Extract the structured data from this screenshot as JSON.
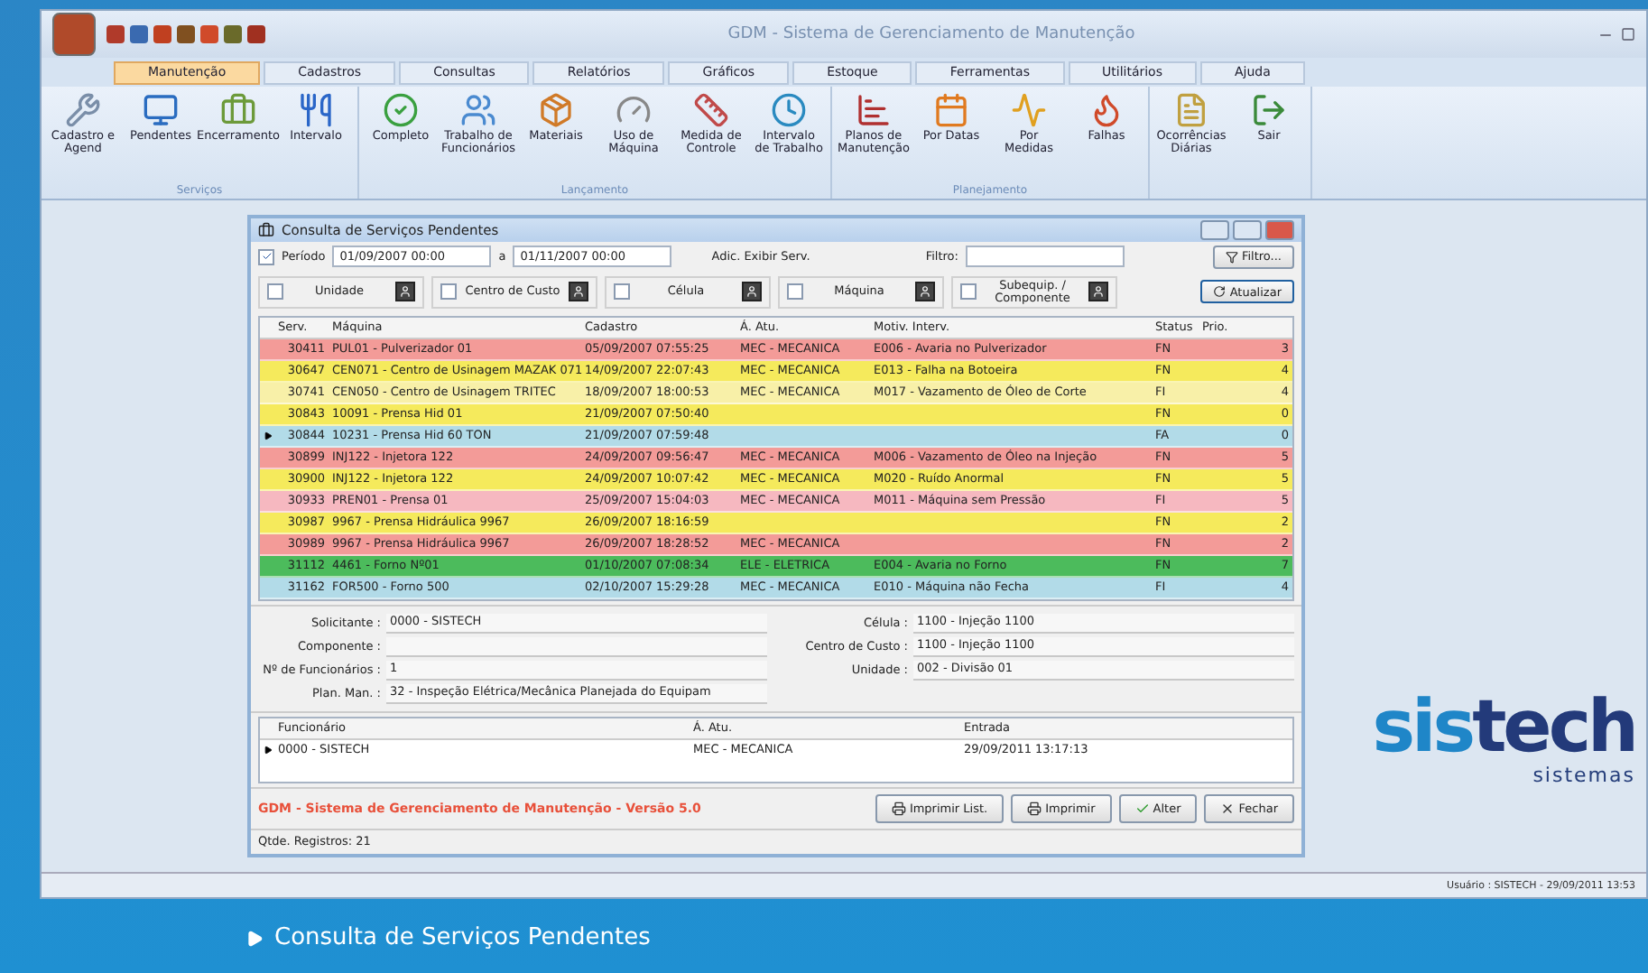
{
  "window": {
    "title": "GDM - Sistema de Gerenciamento de Manutenção"
  },
  "menu": [
    {
      "label": "Manutenção",
      "selected": true
    },
    {
      "label": "Cadastros",
      "selected": false
    },
    {
      "label": "Consultas",
      "selected": false
    },
    {
      "label": "Relatórios",
      "selected": false
    },
    {
      "label": "Gráficos",
      "selected": false
    },
    {
      "label": "Estoque",
      "selected": false
    },
    {
      "label": "Ferramentas",
      "selected": false
    },
    {
      "label": "Utilitários",
      "selected": false
    },
    {
      "label": "Ajuda",
      "selected": false
    }
  ],
  "ribbon": [
    {
      "title": "Serviços",
      "items": [
        "Cadastro e Agend",
        "Pendentes",
        "Encerramento",
        "Intervalo"
      ]
    },
    {
      "title": "Lançamento",
      "items": [
        "Completo",
        "Trabalho de Funcionários",
        "Materiais",
        "Uso de Máquina",
        "Medida de Controle",
        "Intervalo de Trabalho"
      ]
    },
    {
      "title": "Planejamento",
      "items": [
        "Planos de Manutenção",
        "Por Datas",
        "Por Medidas",
        "Falhas"
      ]
    },
    {
      "items": [
        "Ocorrências Diárias",
        "Sair"
      ]
    }
  ],
  "dialog": {
    "title": "Consulta de Serviços Pendentes",
    "period": {
      "label": "Período",
      "checked": true,
      "from": "01/09/2007 00:00",
      "sep": "a",
      "to": "01/11/2007 00:00"
    },
    "show_label": "Adic. Exibir Serv.",
    "filter_label": "Filtro:",
    "filter_button": "Filtro...",
    "refresh_button": "Atualizar",
    "filters": [
      {
        "label": "Unidade",
        "checked": false
      },
      {
        "label": "Centro de Custo",
        "checked": false
      },
      {
        "label": "Célula",
        "checked": false
      },
      {
        "label": "Máquina",
        "checked": false
      },
      {
        "label": "Subequip. / Componente",
        "checked": false
      }
    ],
    "table": {
      "columns": [
        "Serv.",
        "Máquina",
        "Cadastro",
        "Á. Atu.",
        "Motiv. Interv.",
        "Status",
        "Prio."
      ],
      "rows": [
        {
          "cells": [
            "30411",
            "PUL01 - Pulverizador 01",
            "05/09/2007 07:55:25",
            "MEC - MECANICA",
            "E006 - Avaria no Pulverizador",
            "FN",
            "3"
          ],
          "color": "#f39b98",
          "selected": false
        },
        {
          "cells": [
            "30647",
            "CEN071 - Centro de Usinagem MAZAK 071",
            "14/09/2007 22:07:43",
            "MEC - MECANICA",
            "E013 - Falha na Botoeira",
            "FN",
            "4"
          ],
          "color": "#f5ea5c",
          "selected": false
        },
        {
          "cells": [
            "30741",
            "CEN050 - Centro de Usinagem TRITEC",
            "18/09/2007 18:00:53",
            "MEC - MECANICA",
            "M017 - Vazamento de Óleo de Corte",
            "FI",
            "4"
          ],
          "color": "#f8f0a8",
          "selected": false
        },
        {
          "cells": [
            "30843",
            "10091 - Prensa Hid 01",
            "21/09/2007 07:50:40",
            "",
            "",
            "FN",
            "0"
          ],
          "color": "#f5ea5c",
          "selected": false
        },
        {
          "cells": [
            "30844",
            "10231 - Prensa Hid 60 TON",
            "21/09/2007 07:59:48",
            "",
            "",
            "FA",
            "0"
          ],
          "color": "#b2dbe8",
          "selected": true
        },
        {
          "cells": [
            "30899",
            "INJ122 - Injetora 122",
            "24/09/2007 09:56:47",
            "MEC - MECANICA",
            "M006 - Vazamento de Óleo na Injeção",
            "FN",
            "5"
          ],
          "color": "#f39b98",
          "selected": false
        },
        {
          "cells": [
            "30900",
            "INJ122 - Injetora 122",
            "24/09/2007 10:07:42",
            "MEC - MECANICA",
            "M020 - Ruído Anormal",
            "FN",
            "5"
          ],
          "color": "#f5ea5c",
          "selected": false
        },
        {
          "cells": [
            "30933",
            "PREN01 - Prensa 01",
            "25/09/2007 15:04:03",
            "MEC - MECANICA",
            "M011 - Máquina sem Pressão",
            "FI",
            "5"
          ],
          "color": "#f6b8c0",
          "selected": false
        },
        {
          "cells": [
            "30987",
            "9967 - Prensa Hidráulica 9967",
            "26/09/2007 18:16:59",
            "",
            "",
            "FN",
            "2"
          ],
          "color": "#f5ea5c",
          "selected": false
        },
        {
          "cells": [
            "30989",
            "9967 - Prensa Hidráulica 9967",
            "26/09/2007 18:28:52",
            "MEC - MECANICA",
            "",
            "FN",
            "2"
          ],
          "color": "#f39b98",
          "selected": false
        },
        {
          "cells": [
            "31112",
            "4461 - Forno Nº01",
            "01/10/2007 07:08:34",
            "ELE - ELETRICA",
            "E004 - Avaria no Forno",
            "FN",
            "7"
          ],
          "color": "#4cbb5c",
          "selected": false
        },
        {
          "cells": [
            "31162",
            "FOR500 - Forno 500",
            "02/10/2007 15:29:28",
            "MEC - MECANICA",
            "E010 - Máquina não Fecha",
            "FI",
            "4"
          ],
          "color": "#b2dbe8",
          "selected": false
        }
      ]
    },
    "details_left": [
      {
        "label": "Solicitante :",
        "value": "0000 - SISTECH"
      },
      {
        "label": "Componente :"
      },
      {
        "label": "Nº de Funcionários :",
        "value": "1"
      },
      {
        "label": "Plan. Man. :",
        "value": "32 - Inspeção Elétrica/Mecânica Planejada do Equipam"
      }
    ],
    "details_right": [
      {
        "label": "Célula :",
        "value": "1100 - Injeção 1100"
      },
      {
        "label": "Centro de Custo :",
        "value": "1100 - Injeção 1100"
      },
      {
        "label": "Unidade :",
        "value": "002 - Divisão 01"
      }
    ],
    "workers": {
      "columns": [
        "Funcionário",
        "Á. Atu.",
        "Entrada"
      ],
      "rows": [
        {
          "cells": [
            "0000 - SISTECH",
            "MEC - MECANICA",
            "29/09/2011 13:17:13"
          ],
          "selected": true
        }
      ]
    },
    "version": "GDM - Sistema de Gerenciamento de Manutenção - Versão 5.0",
    "buttons": [
      "Imprimir List.",
      "Imprimir",
      "Alter",
      "Fechar"
    ],
    "count": "Qtde. Registros: 21"
  },
  "logo": {
    "parts": [
      "sis",
      "tech"
    ],
    "tagline": "sistemas"
  },
  "status_bar": "Usuário : SISTECH - 29/09/2011 13:53",
  "caption": "Consulta de Serviços Pendentes"
}
